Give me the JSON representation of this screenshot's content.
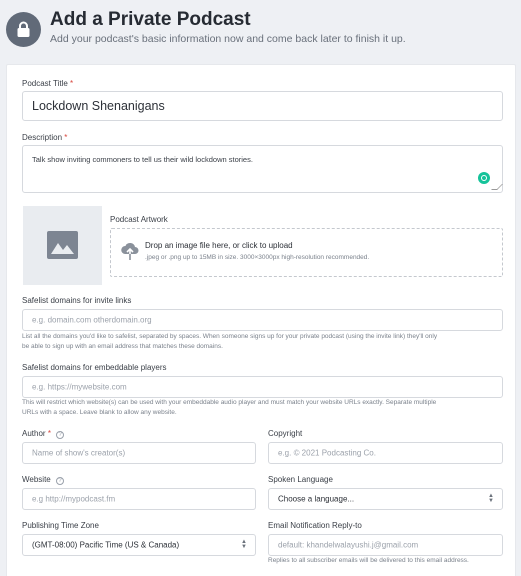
{
  "header": {
    "title": "Add a Private Podcast",
    "subtitle": "Add your podcast's basic information now and come back later to finish it up."
  },
  "form": {
    "title": {
      "label": "Podcast Title",
      "required_mark": "*",
      "value": "Lockdown Shenanigans"
    },
    "description": {
      "label": "Description",
      "required_mark": "*",
      "value": "Talk show inviting commoners to tell us their wild lockdown stories."
    },
    "artwork": {
      "label": "Podcast Artwork",
      "drop_text": "Drop an image file here, or click to upload",
      "drop_hint": ".jpeg or .png up to 15MB in size. 3000×3000px high-resolution recommended."
    },
    "safelist_invite": {
      "label": "Safelist domains for invite links",
      "placeholder": "e.g. domain.com otherdomain.org",
      "hint_line1": "List all the domains you'd like to safelist, separated by spaces. When someone signs up for your private podcast (using the invite link) they'll only",
      "hint_line2": "be able to sign up with an email address that matches these domains."
    },
    "safelist_embed": {
      "label": "Safelist domains for embeddable players",
      "placeholder": "e.g. https://mywebsite.com",
      "hint_line1": "This will restrict which website(s) can be used with your embeddable audio player and must match your website URLs exactly. Separate multiple",
      "hint_line2": "URLs with a space. Leave blank to allow any website."
    },
    "author": {
      "label": "Author",
      "required_mark": "*",
      "help_icon": "?",
      "placeholder": "Name of show's creator(s)"
    },
    "copyright": {
      "label": "Copyright",
      "placeholder": "e.g. © 2021 Podcasting Co."
    },
    "website": {
      "label": "Website",
      "help_icon": "?",
      "placeholder": "e.g http://mypodcast.fm"
    },
    "language": {
      "label": "Spoken Language",
      "value": "Choose a language..."
    },
    "timezone": {
      "label": "Publishing Time Zone",
      "value": "(GMT-08:00) Pacific Time (US & Canada)"
    },
    "reply_to": {
      "label": "Email Notification Reply-to",
      "placeholder": "default: khandelwalayushi.j@gmail.com",
      "hint": "Replies to all subscriber emails will be delivered to this email address."
    }
  },
  "colors": {
    "accent_icon": "#616a78",
    "required": "#d8453b",
    "grammarly": "#15c39a"
  }
}
